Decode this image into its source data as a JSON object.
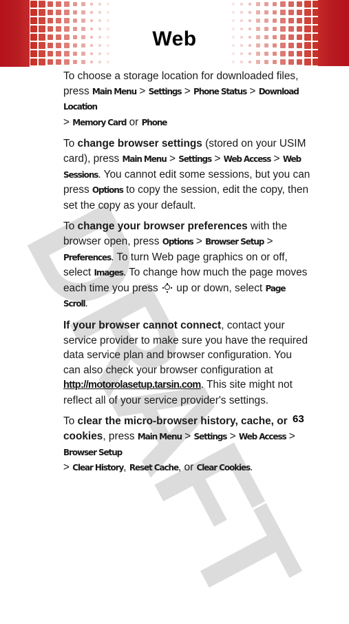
{
  "header": {
    "title": "Web",
    "band_color": "#b5121b"
  },
  "watermark": "DRAFT",
  "paragraphs": {
    "p1": {
      "intro": "To choose a storage location for downloaded files, press ",
      "k1": "Main Menu",
      "sep1": " > ",
      "k2": "Settings",
      "sep2": " > ",
      "k3": "Phone Status",
      "sep3": " > ",
      "k4": "Download Location",
      "sep4": " > ",
      "k5": "Memory Card",
      "or": " or ",
      "k6": "Phone"
    },
    "p2": {
      "to": "To ",
      "bold": "change browser settings",
      "t1": " (stored on your USIM card), press ",
      "k1": "Main Menu",
      "sep1": " > ",
      "k2": "Settings",
      "sep2": " > ",
      "k3": "Web Access",
      "sep3": " > ",
      "k4": "Web Sessions",
      "t2": ". You cannot edit some sessions, but you can press ",
      "k5": "Options",
      "t3": " to copy the session, edit the copy, then set the copy as your default."
    },
    "p3": {
      "to": "To ",
      "bold": "change your browser preferences",
      "t1": " with the browser open, press ",
      "k1": "Options",
      "sep1": " > ",
      "k2": "Browser Setup",
      "sep2": " > ",
      "k3": "Preferences",
      "t2": ". To turn Web page graphics on or off, select ",
      "k4": "Images",
      "t3": ". To change how much the page moves each time you press ",
      "nav_icon": "navigation-key-icon",
      "t4": " up or down, select ",
      "k5": "Page Scroll",
      "t5": "."
    },
    "p4": {
      "bold": "If your browser cannot connect",
      "t1": ", contact your service provider to make sure you have the required data service plan and browser configuration. You can also check your browser configuration at ",
      "link": "http://motorolasetup.tarsin.com",
      "t2": ". This site might not reflect all of your service provider's settings."
    },
    "p5": {
      "to": "To ",
      "bold": "clear the micro-browser history, cache, or cookies",
      "t1": ", press ",
      "k1": "Main Menu",
      "sep1": " > ",
      "k2": "Settings",
      "sep2": " > ",
      "k3": "Web Access",
      "sep3": " > ",
      "k4": "Browser Setup",
      "sep4": " > ",
      "k5": "Clear History",
      "comma1": ", ",
      "k6": "Reset Cache",
      "or": ", or ",
      "k7": "Clear Cookies",
      "end": "."
    }
  },
  "page_number": "63"
}
